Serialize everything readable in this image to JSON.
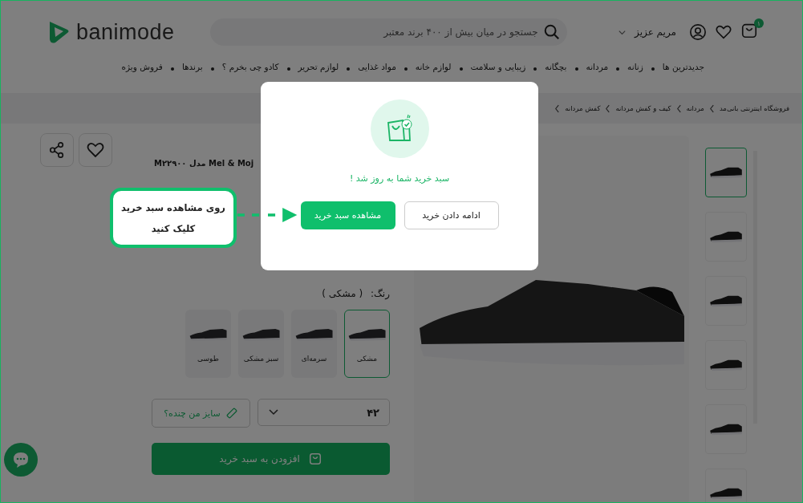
{
  "header": {
    "logo": "banimode",
    "search": {
      "placeholder": "جستجو در میان بیش از ۴۰۰ برند معتبر"
    },
    "user_name": "مریم عزیز",
    "cart_count": "۱"
  },
  "nav": [
    "جدیدترین ها",
    "زنانه",
    "مردانه",
    "بچگانه",
    "زیبایی و سلامت",
    "لوازم خانه",
    "مواد غذایی",
    "لوازم تحریر",
    "کادو چی بخرم ؟",
    "برندها",
    "فروش ویژه"
  ],
  "breadcrumb": [
    "فروشگاه اینترنتی بانی‌مد",
    "مردانه",
    "کیف و کفش مردانه",
    "کفش مردانه"
  ],
  "product": {
    "title": "Mel & Moj مدل M۲۲۹۰۰",
    "color_label": "رنگ:",
    "color_value": "( مشکی )",
    "swatches": [
      {
        "name": "مشکی",
        "selected": true
      },
      {
        "name": "سرمه‌ای",
        "selected": false
      },
      {
        "name": "سبز مشکی",
        "selected": false
      },
      {
        "name": "طوسی",
        "selected": false
      }
    ],
    "size": "۴۲",
    "size_guide": "سایز من چنده؟",
    "add_to_cart": "افزودن به سبد خرید",
    "thumbnails": [
      {
        "selected": true
      },
      {
        "selected": false
      },
      {
        "selected": false
      },
      {
        "selected": false
      },
      {
        "selected": false
      },
      {
        "selected": false
      }
    ]
  },
  "modal": {
    "message": "سبد خرید شما به روز شد !",
    "buttons": [
      {
        "label": "ادامه دادن خرید",
        "kind": "secondary"
      },
      {
        "label": "مشاهده سبد خرید",
        "kind": "primary"
      }
    ]
  },
  "callout": {
    "text": "روی مشاهده سبد خرید کلیک کنید"
  }
}
